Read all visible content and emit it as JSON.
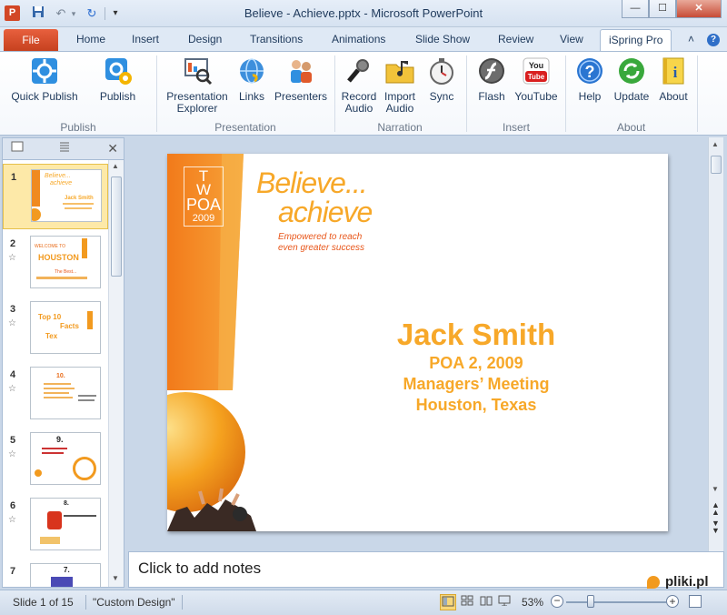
{
  "window": {
    "title": "Believe - Achieve.pptx - Microsoft PowerPoint",
    "app_letter": "P",
    "controls": [
      "—",
      "☐",
      "✕"
    ]
  },
  "qat": {
    "save": "💾",
    "undo": "↶",
    "redo": "↻",
    "more": "▾"
  },
  "tabs": {
    "file": "File",
    "items": [
      "Home",
      "Insert",
      "Design",
      "Transitions",
      "Animations",
      "Slide Show",
      "Review",
      "View"
    ],
    "active": "iSpring Pro",
    "help_glyph": "?",
    "collapse_glyph": "˄"
  },
  "ribbon": {
    "groups": [
      {
        "label": "Publish",
        "buttons": [
          {
            "label": "Quick Publish",
            "icon": "quick-publish-icon"
          },
          {
            "label": "Publish",
            "icon": "publish-icon"
          }
        ]
      },
      {
        "label": "Presentation",
        "buttons": [
          {
            "label": "Presentation Explorer",
            "icon": "presentation-explorer-icon"
          },
          {
            "label": "Links",
            "icon": "links-icon"
          },
          {
            "label": "Presenters",
            "icon": "presenters-icon"
          }
        ]
      },
      {
        "label": "Narration",
        "buttons": [
          {
            "label": "Record Audio",
            "icon": "microphone-icon"
          },
          {
            "label": "Import Audio",
            "icon": "folder-audio-icon"
          },
          {
            "label": "Sync",
            "icon": "stopwatch-icon"
          }
        ]
      },
      {
        "label": "Insert",
        "buttons": [
          {
            "label": "Flash",
            "icon": "flash-icon"
          },
          {
            "label": "YouTube",
            "icon": "youtube-icon"
          }
        ]
      },
      {
        "label": "About",
        "buttons": [
          {
            "label": "Help",
            "icon": "help-icon"
          },
          {
            "label": "Update",
            "icon": "update-icon"
          },
          {
            "label": "About",
            "icon": "about-icon"
          }
        ]
      }
    ]
  },
  "pane": {
    "close_glyph": "✕",
    "slides": [
      {
        "num": "1",
        "selected": true,
        "lines": [
          "Believe...",
          "achieve",
          "Jack Smith"
        ]
      },
      {
        "num": "2",
        "lines": [
          "WELCOME TO",
          "HOUSTON",
          "The Best..."
        ]
      },
      {
        "num": "3",
        "lines": [
          "Top 10",
          "Facts",
          "Tex"
        ]
      },
      {
        "num": "4",
        "lines": [
          "10."
        ]
      },
      {
        "num": "5",
        "lines": [
          "9."
        ]
      },
      {
        "num": "6",
        "lines": [
          "8."
        ]
      },
      {
        "num": "7",
        "lines": [
          "7."
        ]
      }
    ]
  },
  "slide": {
    "logo_letters": [
      "T",
      "W"
    ],
    "logo_text": "POA",
    "logo_year": "2009",
    "headline1": "Believe...",
    "headline2": "achieve",
    "tagline1": "Empowered to reach",
    "tagline2": "even greater success",
    "name": "Jack Smith",
    "line1": "POA 2, 2009",
    "line2": "Managers’ Meeting",
    "line3": "Houston, Texas",
    "accent": "#f7a829",
    "band_color": "#f08a1f"
  },
  "notes": {
    "placeholder": "Click to add notes"
  },
  "status": {
    "slide_info": "Slide 1 of 15",
    "theme": "\"Custom Design\"",
    "zoom": "53%",
    "watermark": "pliki.pl"
  }
}
